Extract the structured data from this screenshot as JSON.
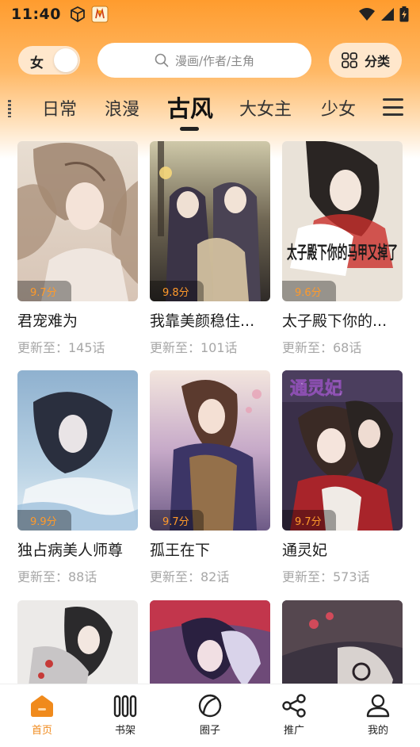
{
  "status": {
    "time": "11:40",
    "colors": {
      "text": "#1a1a1a"
    }
  },
  "header": {
    "gender_label": "女",
    "search_placeholder": "漫画/作者/主角",
    "category_label": "分类"
  },
  "tabs": [
    {
      "label": "日常",
      "active": false
    },
    {
      "label": "浪漫",
      "active": false
    },
    {
      "label": "古风",
      "active": true
    },
    {
      "label": "大女主",
      "active": false
    },
    {
      "label": "少女",
      "active": false
    }
  ],
  "comics": [
    {
      "title": "君宠难为",
      "rating": "9.7分",
      "update": "更新至：145话"
    },
    {
      "title": "我靠美颜稳住...",
      "rating": "9.8分",
      "update": "更新至：101话"
    },
    {
      "title": "太子殿下你的...",
      "rating": "9.6分",
      "update": "更新至：68话"
    },
    {
      "title": "独占病美人师尊",
      "rating": "9.9分",
      "update": "更新至：88话"
    },
    {
      "title": "孤王在下",
      "rating": "9.7分",
      "update": "更新至：82话"
    },
    {
      "title": "通灵妃",
      "rating": "9.7分",
      "update": "更新至：573话"
    }
  ],
  "cover_text": {
    "c3": "太子殿下你的马甲又掉了",
    "c6": "通灵妃"
  },
  "bottom_nav": [
    {
      "label": "首页",
      "icon": "home-icon",
      "active": true
    },
    {
      "label": "书架",
      "icon": "bookshelf-icon",
      "active": false
    },
    {
      "label": "圈子",
      "icon": "circle-icon",
      "active": false
    },
    {
      "label": "推广",
      "icon": "share-icon",
      "active": false
    },
    {
      "label": "我的",
      "icon": "profile-icon",
      "active": false
    }
  ],
  "colors": {
    "accent": "#f08a1c",
    "rating": "#ff9a2a",
    "header_gradient_top": "#ff9c2e"
  }
}
